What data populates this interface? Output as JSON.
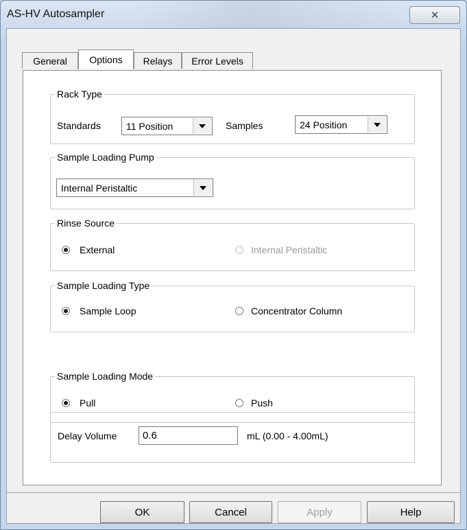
{
  "window": {
    "title": "AS-HV Autosampler",
    "close_glyph": "✕"
  },
  "tabs": [
    {
      "label": "General"
    },
    {
      "label": "Options"
    },
    {
      "label": "Relays"
    },
    {
      "label": "Error Levels"
    }
  ],
  "active_tab": "Options",
  "rack_type": {
    "legend": "Rack Type",
    "standards_label": "Standards",
    "standards_value": "11 Position",
    "samples_label": "Samples",
    "samples_value": "24 Position"
  },
  "sample_loading_pump": {
    "legend": "Sample Loading Pump",
    "value": "Internal Peristaltic"
  },
  "rinse_source": {
    "legend": "Rinse Source",
    "options": [
      {
        "label": "External",
        "checked": true,
        "enabled": true
      },
      {
        "label": "Internal Peristaltic",
        "checked": false,
        "enabled": false
      }
    ]
  },
  "sample_loading_type": {
    "legend": "Sample Loading Type",
    "options": [
      {
        "label": "Sample Loop",
        "checked": true,
        "enabled": true
      },
      {
        "label": "Concentrator Column",
        "checked": false,
        "enabled": true
      }
    ]
  },
  "sample_loading_mode": {
    "legend": "Sample Loading Mode",
    "options": [
      {
        "label": "Pull",
        "checked": true,
        "enabled": true
      },
      {
        "label": "Push",
        "checked": false,
        "enabled": true
      }
    ]
  },
  "delay_volume": {
    "label": "Delay Volume",
    "value": "0.6",
    "range_text": "mL (0.00 - 4.00mL)"
  },
  "buttons": {
    "ok": "OK",
    "cancel": "Cancel",
    "apply": "Apply",
    "help": "Help"
  },
  "colors": {
    "title_bar": "#c6d6ea",
    "panel": "#ffffff",
    "dialog": "#f0f0f0",
    "disabled_text": "#9b9b9b"
  }
}
